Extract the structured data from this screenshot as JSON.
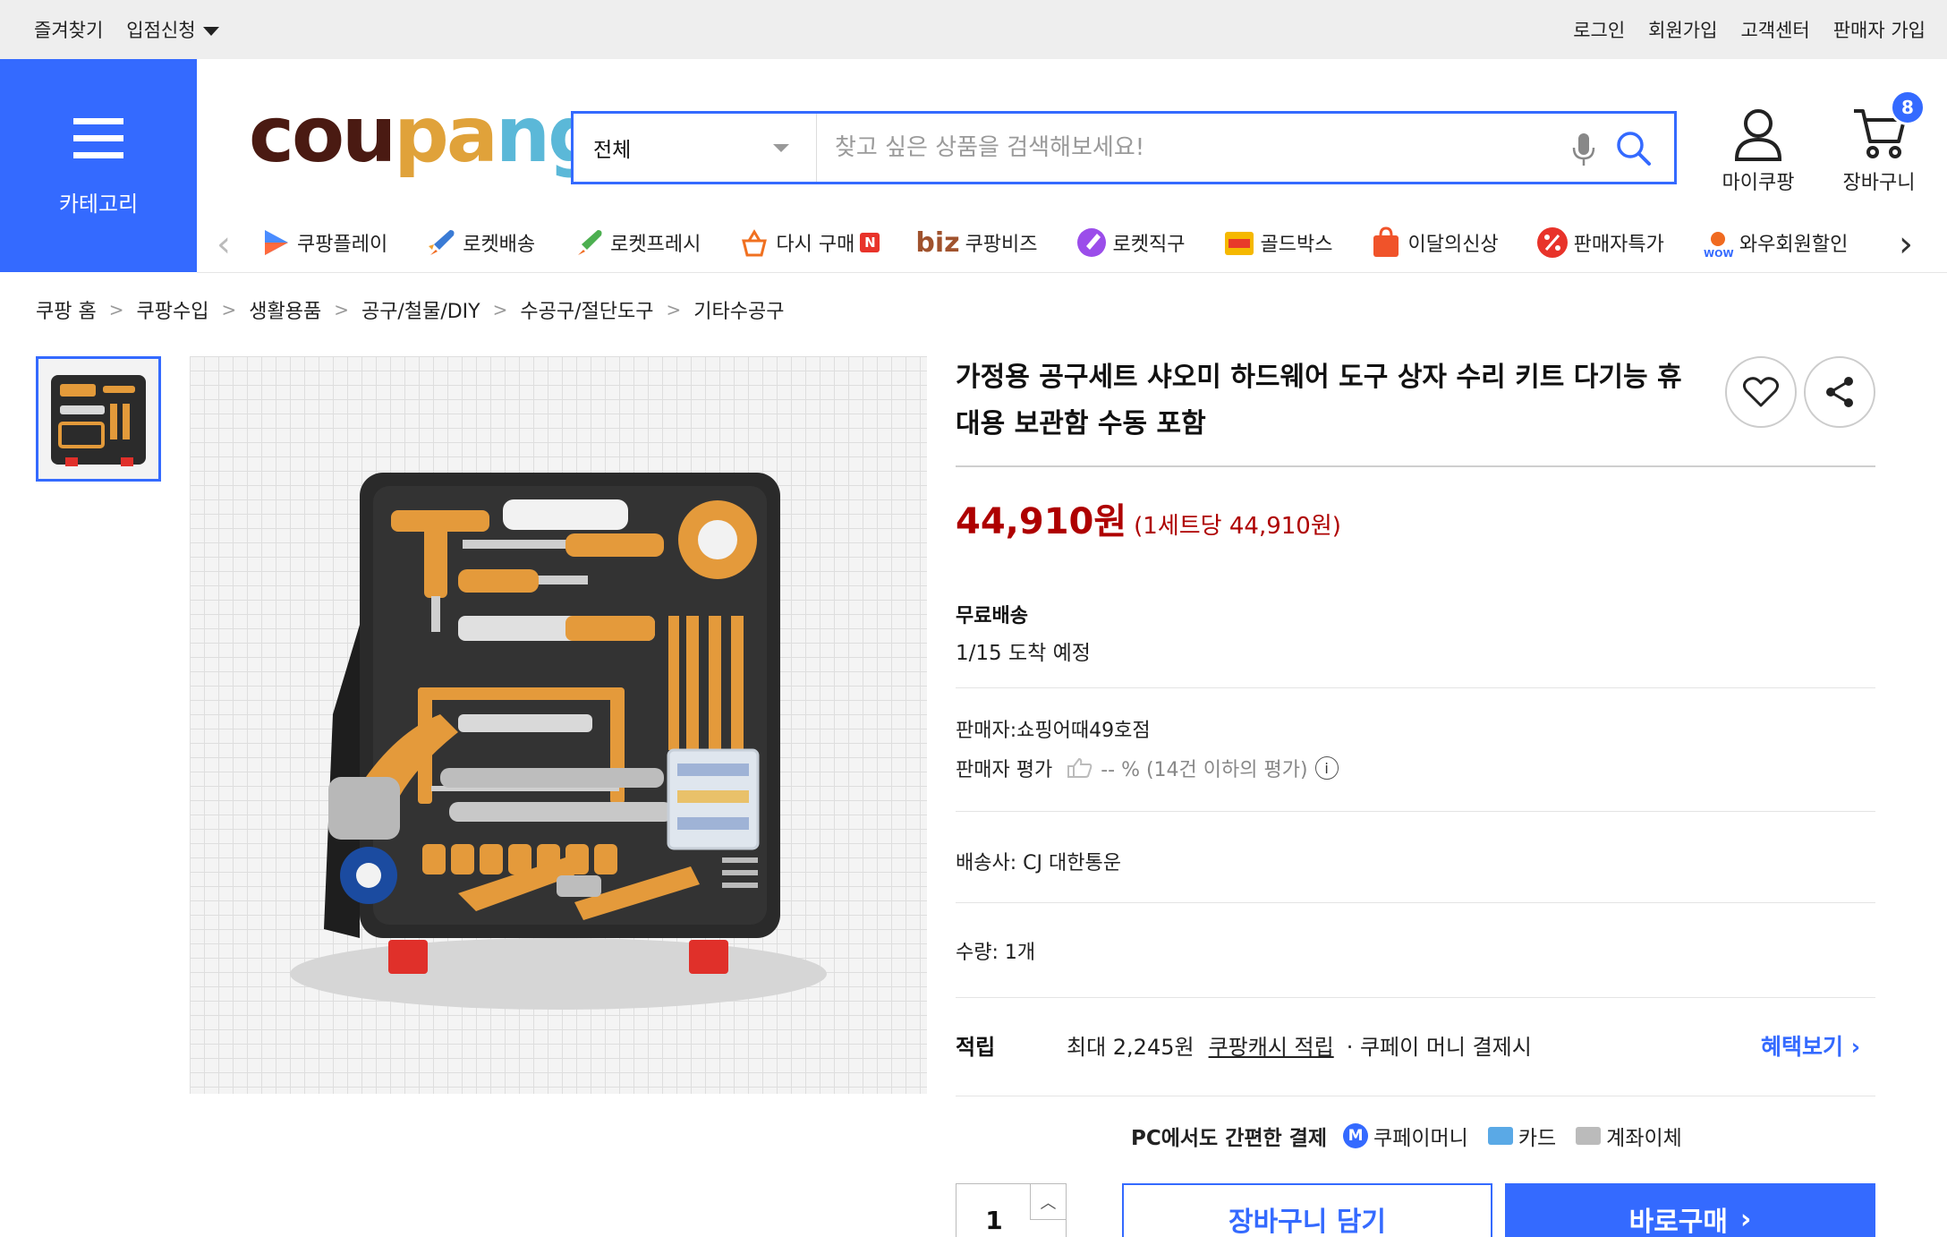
{
  "topbar": {
    "bookmark": "즐겨찾기",
    "apply": "입점신청",
    "login": "로그인",
    "signup": "회원가입",
    "support": "고객센터",
    "seller_join": "판매자 가입"
  },
  "category": {
    "label": "카테고리"
  },
  "logo": {
    "part1": "cou",
    "part2": "pa",
    "part3": "ng"
  },
  "search": {
    "category": "전체",
    "placeholder": "찾고 싶은 상품을 검색해보세요!"
  },
  "header": {
    "my": "마이쿠팡",
    "cart": "장바구니",
    "cart_count": "8"
  },
  "quicknav": [
    {
      "label": "쿠팡플레이"
    },
    {
      "label": "로켓배송"
    },
    {
      "label": "로켓프레시"
    },
    {
      "label": "다시 구매"
    },
    {
      "label": "쿠팡비즈",
      "prefix": "biz"
    },
    {
      "label": "로켓직구"
    },
    {
      "label": "골드박스"
    },
    {
      "label": "이달의신상"
    },
    {
      "label": "판매자특가"
    },
    {
      "label": "와우회원할인"
    }
  ],
  "breadcrumb": [
    "쿠팡 홈",
    "쿠팡수입",
    "생활용품",
    "공구/철물/DIY",
    "수공구/절단도구",
    "기타수공구"
  ],
  "product": {
    "title": "가정용 공구세트 샤오미 하드웨어 도구 상자 수리 키트 다기능 휴대용 보관함 수동 포함",
    "price": "44,910원",
    "unit_price": "(1세트당 44,910원)",
    "shipping_title": "무료배송",
    "arrival": "1/15 도착 예정",
    "seller": "판매자:쇼핑어때49호점",
    "seller_rating_label": "판매자 평가",
    "seller_rating_value": "-- % (14건 이하의 평가)",
    "carrier": "배송사:  CJ 대한통운",
    "quantity_label": "수량:  1개",
    "reward_label": "적립",
    "reward_max": "최대 2,245원",
    "reward_link": "쿠팡캐시 적립",
    "reward_note": "· 쿠페이 머니 결제시",
    "benefit": "혜택보기",
    "pay_lead": "PC에서도 간편한 결제",
    "pay_options": [
      "쿠페이머니",
      "카드",
      "계좌이체"
    ],
    "qty_value": "1",
    "add_cart": "장바구니 담기",
    "buy_now": "바로구매"
  },
  "colors": {
    "accent": "#346aff",
    "price": "#ae0000"
  }
}
